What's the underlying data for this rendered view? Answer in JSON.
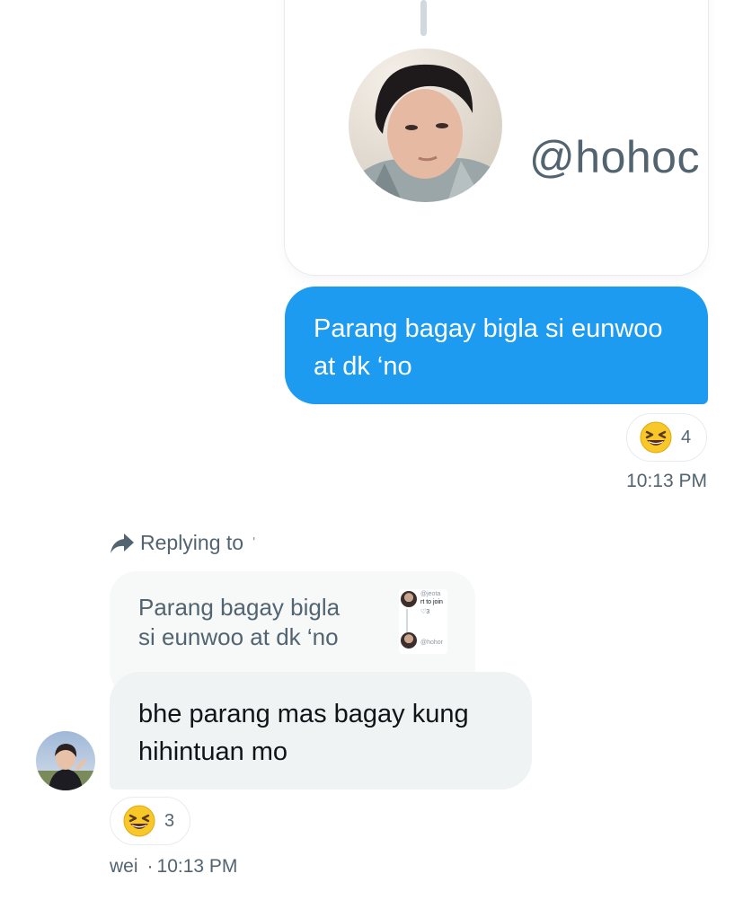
{
  "shared_card": {
    "handle": "@hohoc"
  },
  "sent_message": {
    "text": "Parang bagay bigla si eunwoo at dk ‘no",
    "reaction": {
      "emoji": "grinning-squinting-face",
      "count": "4"
    },
    "timestamp": "10:13 PM"
  },
  "reply": {
    "replying_label": "Replying to",
    "replying_target": "'",
    "quoted_text": "Parang bagay bigla si eunwoo at dk ‘no",
    "quoted_thumb": {
      "line1": "@jeota",
      "line2": "rt to join",
      "line3": "♡3",
      "handle": "@hohor"
    }
  },
  "received_message": {
    "text": "bhe parang mas bagay kung hihintuan mo",
    "reaction": {
      "emoji": "grinning-squinting-face",
      "count": "3"
    },
    "sender_name": "wei",
    "separator": "·",
    "timestamp": "10:13 PM"
  },
  "colors": {
    "accent": "#1d9bf0",
    "received_bubble": "#eff3f4",
    "muted_text": "#536471"
  }
}
